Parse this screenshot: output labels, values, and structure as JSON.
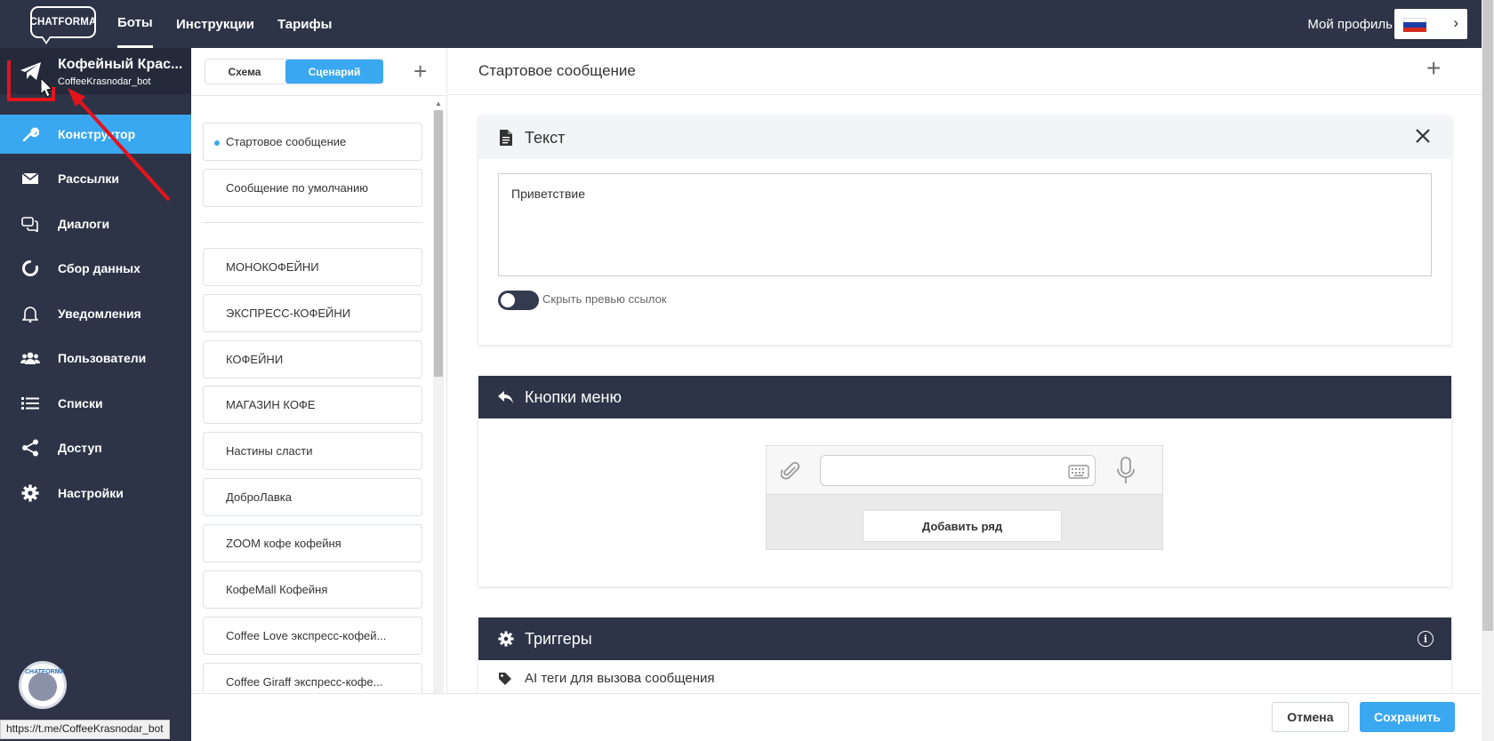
{
  "topbar": {
    "logo_text": "CHATFORMA",
    "nav": [
      "Боты",
      "Инструкции",
      "Тарифы"
    ],
    "profile_label": "Мой профиль",
    "lang_chevron": "›"
  },
  "bot": {
    "name": "Кофейный Крас...",
    "handle": "CoffeeKrasnodar_bot"
  },
  "sidebar": {
    "items": [
      {
        "label": "Конструктор",
        "icon": "wrench-icon"
      },
      {
        "label": "Рассылки",
        "icon": "envelope-icon"
      },
      {
        "label": "Диалоги",
        "icon": "chat-icon"
      },
      {
        "label": "Сбор данных",
        "icon": "pie-chart-icon"
      },
      {
        "label": "Уведомления",
        "icon": "bell-icon"
      },
      {
        "label": "Пользователи",
        "icon": "users-icon"
      },
      {
        "label": "Списки",
        "icon": "list-icon"
      },
      {
        "label": "Доступ",
        "icon": "share-icon"
      },
      {
        "label": "Настройки",
        "icon": "gear-icon"
      }
    ],
    "avatar_text": "CHATFORMA"
  },
  "status_url": "https://t.me/CoffeeKrasnodar_bot",
  "scenario": {
    "tab_schema": "Схема",
    "tab_scenario": "Сценарий",
    "plus": "+",
    "system_items": [
      "Стартовое сообщение",
      "Сообщение по умолчанию"
    ],
    "items": [
      "МОНОКОФЕЙНИ",
      "ЭКСПРЕСС-КОФЕЙНИ",
      "КОФЕЙНИ",
      "МАГАЗИН КОФЕ",
      "Настины сласти",
      "ДоброЛавка",
      "ZOOM кофе кофейня",
      "КофеMall Кофейня",
      "Coffee Love экспресс-кофей...",
      "Coffee Giraff экспресс-кофе..."
    ]
  },
  "main": {
    "title": "Стартовое сообщение",
    "plus": "+",
    "text_card": {
      "title": "Текст",
      "value": "Приветствие",
      "toggle_label": "Скрыть превью ссылок",
      "toggle_on": false
    },
    "menu_card": {
      "title": "Кнопки меню",
      "add_row": "Добавить ряд"
    },
    "triggers_card": {
      "title": "Триггеры",
      "info": "i",
      "ai_tags": "AI теги для вызова сообщения"
    }
  },
  "footer": {
    "cancel": "Отмена",
    "save": "Сохранить"
  },
  "colors": {
    "dark": "#2e3447",
    "accent": "#3aa8f0",
    "annotation": "#e3141c"
  }
}
